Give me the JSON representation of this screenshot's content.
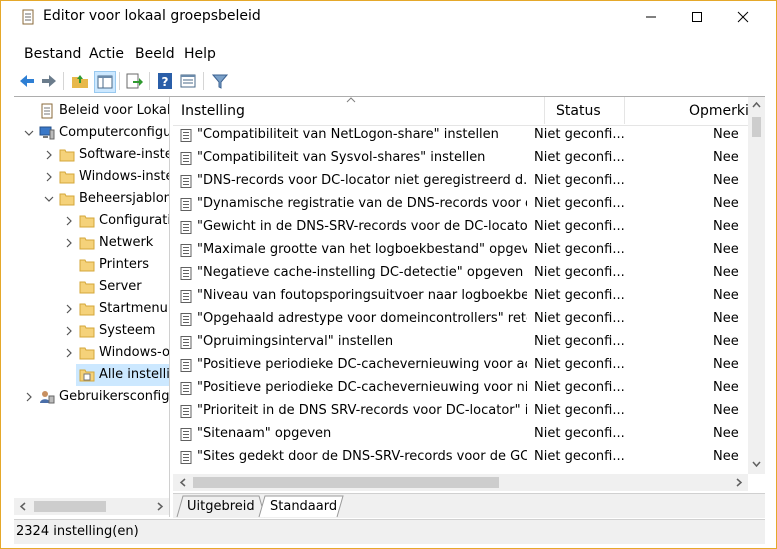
{
  "window": {
    "title": "Editor voor lokaal groepsbeleid",
    "accent_border": "#e5a82a"
  },
  "menu": [
    "Bestand",
    "Actie",
    "Beeld",
    "Help"
  ],
  "toolbar": {
    "buttons": [
      "back-arrow-icon",
      "forward-arrow-icon",
      "up-folder-icon",
      "show-hide-tree-icon",
      "export-list-icon",
      "help-icon",
      "properties-view-icon",
      "filter-icon"
    ]
  },
  "tree": {
    "items": [
      {
        "label": "Beleid voor Lokale co",
        "expander": "",
        "icon": "policy-scroll-icon"
      },
      {
        "label": "Computerconfigur",
        "expander": "expanded",
        "icon": "computer-icon"
      },
      {
        "label": "Software-instell",
        "expander": "collapsed",
        "icon": "folder-icon"
      },
      {
        "label": "Windows-instel",
        "expander": "collapsed",
        "icon": "folder-icon"
      },
      {
        "label": "Beheersjablone",
        "expander": "expanded",
        "icon": "folder-icon"
      },
      {
        "label": "Configuratie",
        "expander": "collapsed",
        "icon": "folder-icon"
      },
      {
        "label": "Netwerk",
        "expander": "collapsed",
        "icon": "folder-icon"
      },
      {
        "label": "Printers",
        "expander": "",
        "icon": "folder-icon"
      },
      {
        "label": "Server",
        "expander": "",
        "icon": "folder-icon"
      },
      {
        "label": "Startmenu e",
        "expander": "collapsed",
        "icon": "folder-icon"
      },
      {
        "label": "Systeem",
        "expander": "collapsed",
        "icon": "folder-icon"
      },
      {
        "label": "Windows-o",
        "expander": "collapsed",
        "icon": "folder-icon"
      },
      {
        "label": "Alle instellin",
        "expander": "",
        "icon": "settings-page-icon"
      },
      {
        "label": "Gebruikersconfigu",
        "expander": "collapsed",
        "icon": "user-icon"
      }
    ]
  },
  "list": {
    "columns": [
      "Instelling",
      "Status",
      "Opmerkin"
    ],
    "rows": [
      {
        "setting": "\"Compatibiliteit van NetLogon-share\" instellen",
        "status": "Niet geconfi...",
        "comment": "Nee"
      },
      {
        "setting": "\"Compatibiliteit van Sysvol-shares\" instellen",
        "status": "Niet geconfi...",
        "comment": "Nee"
      },
      {
        "setting": "\"DNS-records voor DC-locator niet geregistreerd d...",
        "status": "Niet geconfi...",
        "comment": "Nee"
      },
      {
        "setting": "\"Dynamische registratie van de DNS-records voor d...",
        "status": "Niet geconfi...",
        "comment": "Nee"
      },
      {
        "setting": "\"Gewicht in de DNS-SRV-records voor de DC-locato...",
        "status": "Niet geconfi...",
        "comment": "Nee"
      },
      {
        "setting": "\"Maximale grootte van het logboekbestand\" opgev...",
        "status": "Niet geconfi...",
        "comment": "Nee"
      },
      {
        "setting": "\"Negatieve cache-instelling DC-detectie\" opgeven",
        "status": "Niet geconfi...",
        "comment": "Nee"
      },
      {
        "setting": "\"Niveau van foutopsporingsuitvoer naar logboekbe...",
        "status": "Niet geconfi...",
        "comment": "Nee"
      },
      {
        "setting": "\"Opgehaald adrestype voor domeincontrollers\" reto...",
        "status": "Niet geconfi...",
        "comment": "Nee"
      },
      {
        "setting": "\"Opruimingsinterval\" instellen",
        "status": "Niet geconfi...",
        "comment": "Nee"
      },
      {
        "setting": "\"Positieve periodieke DC-cachevernieuwing voor ac...",
        "status": "Niet geconfi...",
        "comment": "Nee"
      },
      {
        "setting": "\"Positieve periodieke DC-cachevernieuwing voor nie...",
        "status": "Niet geconfi...",
        "comment": "Nee"
      },
      {
        "setting": "\"Prioriteit in de DNS SRV-records voor DC-locator\" i...",
        "status": "Niet geconfi...",
        "comment": "Nee"
      },
      {
        "setting": "\"Sitenaam\" opgeven",
        "status": "Niet geconfi...",
        "comment": "Nee"
      },
      {
        "setting": "\"Sites gedekt door de DNS-SRV-records voor de GC...",
        "status": "Niet geconfi...",
        "comment": "Nee"
      }
    ]
  },
  "tabs": [
    "Uitgebreid",
    "Standaard"
  ],
  "active_tab": "Standaard",
  "status": "2324 instelling(en)"
}
